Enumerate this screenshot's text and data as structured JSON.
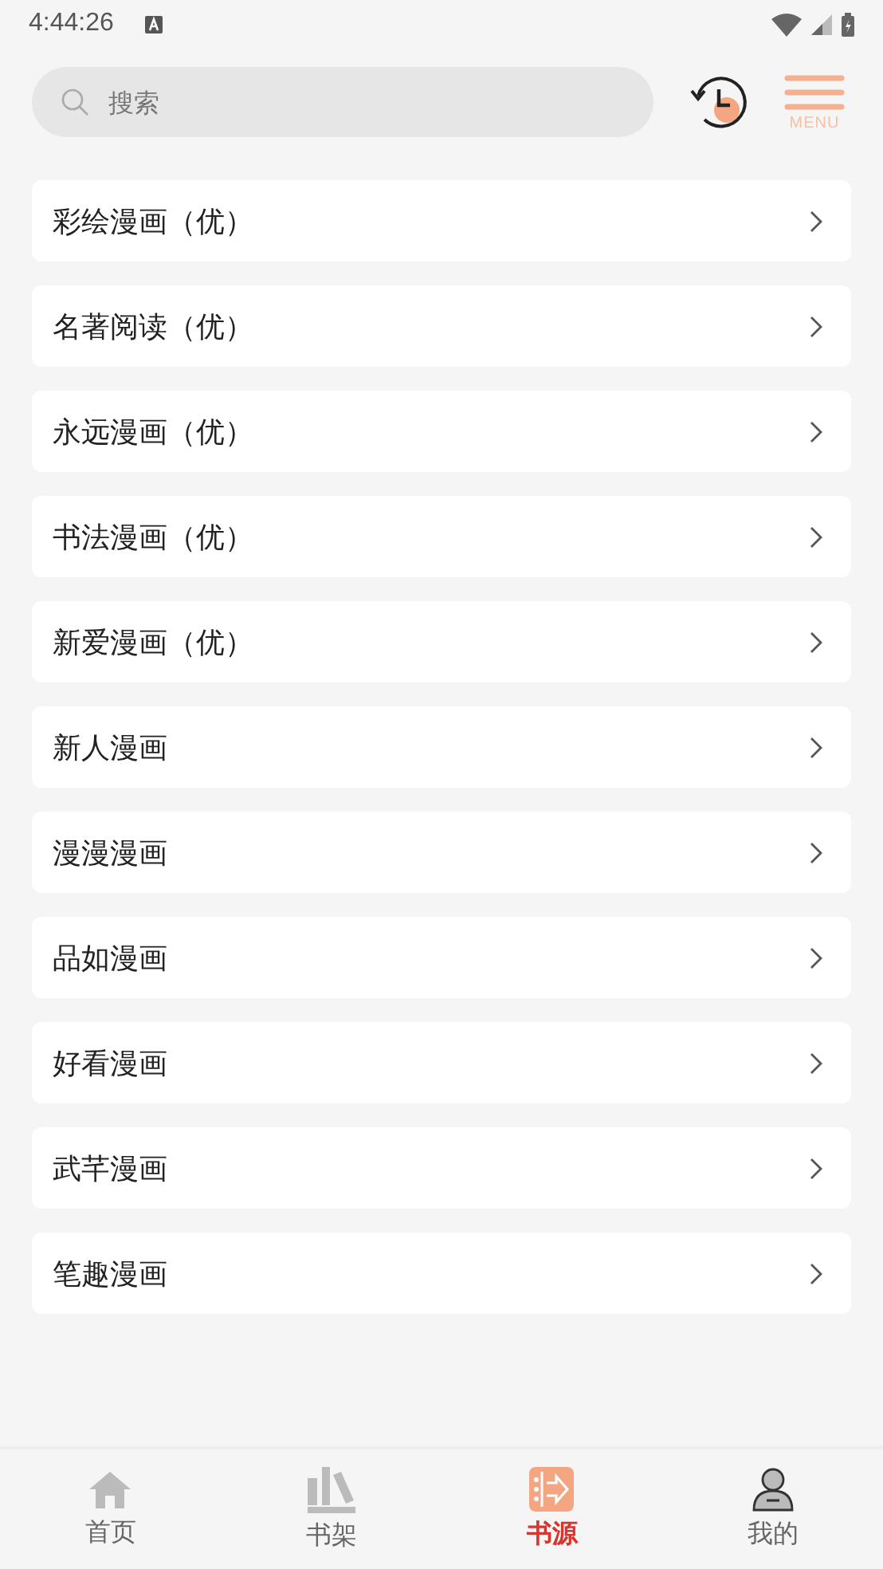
{
  "status_bar": {
    "time": "4:44:26"
  },
  "search": {
    "placeholder": "搜索"
  },
  "header": {
    "menu_label": "MENU"
  },
  "sources": [
    {
      "name": "彩绘漫画（优）"
    },
    {
      "name": "名著阅读（优）"
    },
    {
      "name": "永远漫画（优）"
    },
    {
      "name": "书法漫画（优）"
    },
    {
      "name": "新爱漫画（优）"
    },
    {
      "name": "新人漫画"
    },
    {
      "name": "漫漫漫画"
    },
    {
      "name": "品如漫画"
    },
    {
      "name": "好看漫画"
    },
    {
      "name": "武芊漫画"
    },
    {
      "name": "笔趣漫画"
    }
  ],
  "tabs": [
    {
      "label": "首页",
      "kind": "home",
      "selected": false
    },
    {
      "label": "书架",
      "kind": "shelf",
      "selected": false
    },
    {
      "label": "书源",
      "kind": "source",
      "selected": true
    },
    {
      "label": "我的",
      "kind": "profile",
      "selected": false
    }
  ]
}
